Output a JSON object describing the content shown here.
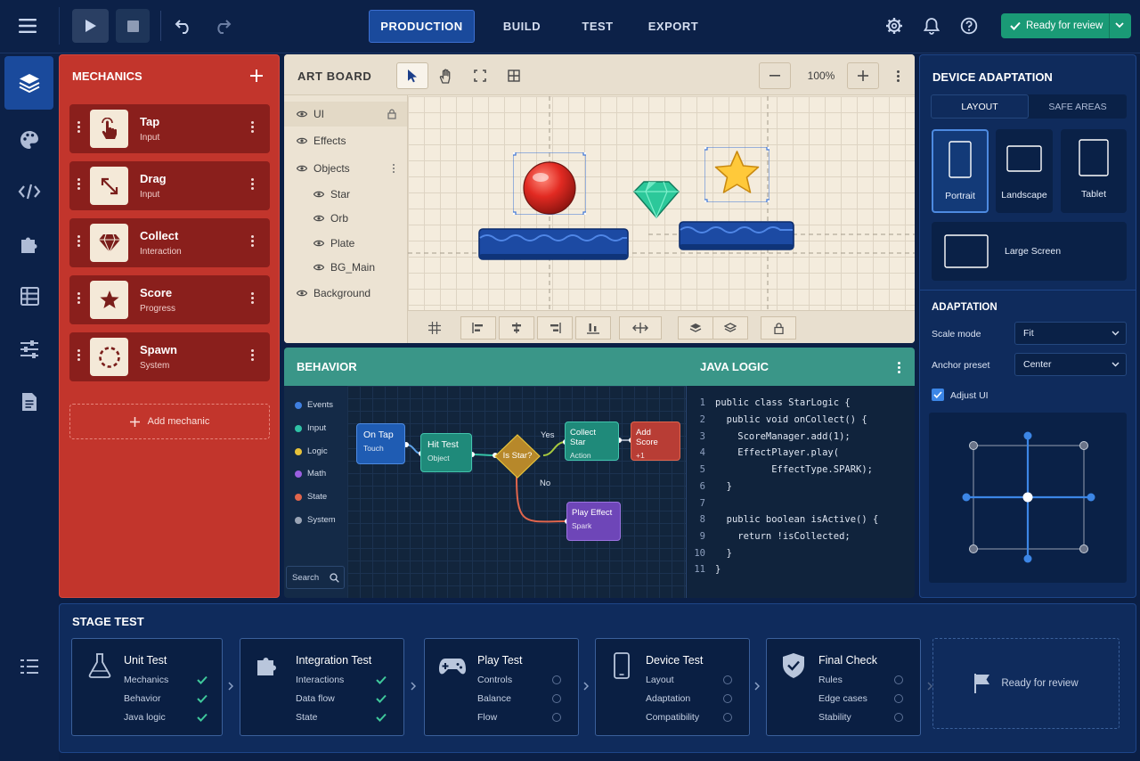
{
  "toolbar": {
    "tabs": [
      "PRODUCTION",
      "BUILD",
      "TEST",
      "EXPORT"
    ],
    "active_tab": "PRODUCTION",
    "review_label": "Ready for review"
  },
  "rail": {
    "icons": [
      "layers-icon",
      "palette-icon",
      "code-icon",
      "puzzle-icon",
      "table-icon",
      "sliders-icon",
      "document-icon"
    ]
  },
  "mechanics": {
    "title": "MECHANICS",
    "items": [
      {
        "title": "Tap",
        "sub": "Input",
        "icon": "tap-icon"
      },
      {
        "title": "Drag",
        "sub": "Input",
        "icon": "drag-icon"
      },
      {
        "title": "Collect",
        "sub": "Interaction",
        "icon": "gem-icon"
      },
      {
        "title": "Score",
        "sub": "Progress",
        "icon": "star-icon"
      },
      {
        "title": "Spawn",
        "sub": "System",
        "icon": "spawn-icon"
      }
    ],
    "add_label": "Add mechanic"
  },
  "artboard": {
    "title": "ART BOARD",
    "zoom": "100%",
    "layers": [
      {
        "label": "UI"
      },
      {
        "label": "Effects"
      },
      {
        "label": "Objects"
      },
      {
        "label": "Star"
      },
      {
        "label": "Orb"
      },
      {
        "label": "Plate"
      },
      {
        "label": "BG_Main"
      },
      {
        "label": "Background"
      }
    ]
  },
  "behavior": {
    "title": "BEHAVIOR",
    "legend": [
      {
        "label": "Events",
        "color": "#3f7fe0"
      },
      {
        "label": "Input",
        "color": "#2fc1a5"
      },
      {
        "label": "Logic",
        "color": "#e6c23a"
      },
      {
        "label": "Math",
        "color": "#9b5fe0"
      },
      {
        "label": "State",
        "color": "#e0654c"
      },
      {
        "label": "System",
        "color": "#9aa4b5"
      }
    ],
    "search_label": "Search",
    "nodes": {
      "on_tap": {
        "title": "On Tap",
        "sub": "Touch"
      },
      "hit_test": {
        "title": "Hit Test",
        "sub": "Object"
      },
      "is_star": {
        "title": "Is Star?"
      },
      "collect_star": {
        "title": "Collect Star",
        "sub": "Action"
      },
      "add_score": {
        "title": "Add Score",
        "sub": "+1"
      },
      "play_effect": {
        "title": "Play Effect",
        "sub": "Spark"
      }
    },
    "yes_label": "Yes",
    "no_label": "No"
  },
  "java": {
    "title": "JAVA LOGIC",
    "lines": [
      {
        "n": "1",
        "code": "public class StarLogic {"
      },
      {
        "n": "2",
        "code": "  public void onCollect() {"
      },
      {
        "n": "3",
        "code": "    ScoreManager.add(1);"
      },
      {
        "n": "4",
        "code": "    EffectPlayer.play("
      },
      {
        "n": "5",
        "code": "          EffectType.SPARK);"
      },
      {
        "n": "6",
        "code": "  }"
      },
      {
        "n": "7",
        "code": ""
      },
      {
        "n": "8",
        "code": "  public boolean isActive() {"
      },
      {
        "n": "9",
        "code": "    return !isCollected;"
      },
      {
        "n": "10",
        "code": "  }"
      },
      {
        "n": "11",
        "code": "}"
      }
    ]
  },
  "device": {
    "title": "DEVICE ADAPTATION",
    "tabs": [
      "LAYOUT",
      "SAFE AREAS"
    ],
    "active_tab": "LAYOUT",
    "formats": [
      "Portrait",
      "Landscape",
      "Tablet",
      "Large Screen"
    ],
    "selected_format": "Portrait",
    "adaptation_title": "ADAPTATION",
    "scale_label": "Scale mode",
    "scale_value": "Fit",
    "anchor_label": "Anchor preset",
    "anchor_value": "Center",
    "adjust_label": "Adjust UI",
    "adjust_checked": true
  },
  "stage": {
    "title": "STAGE TEST",
    "cards": [
      {
        "title": "Unit Test",
        "icon": "flask-icon",
        "rows": [
          {
            "label": "Mechanics",
            "done": true
          },
          {
            "label": "Behavior",
            "done": true
          },
          {
            "label": "Java logic",
            "done": true
          }
        ]
      },
      {
        "title": "Integration Test",
        "icon": "puzzle-icon",
        "rows": [
          {
            "label": "Interactions",
            "done": true
          },
          {
            "label": "Data flow",
            "done": true
          },
          {
            "label": "State",
            "done": true
          }
        ]
      },
      {
        "title": "Play Test",
        "icon": "gamepad-icon",
        "rows": [
          {
            "label": "Controls",
            "done": false
          },
          {
            "label": "Balance",
            "done": false
          },
          {
            "label": "Flow",
            "done": false
          }
        ]
      },
      {
        "title": "Device Test",
        "icon": "phone-icon",
        "rows": [
          {
            "label": "Layout",
            "done": false
          },
          {
            "label": "Adaptation",
            "done": false
          },
          {
            "label": "Compatibility",
            "done": false
          }
        ]
      },
      {
        "title": "Final Check",
        "icon": "shield-check-icon",
        "rows": [
          {
            "label": "Rules",
            "done": false
          },
          {
            "label": "Edge cases",
            "done": false
          },
          {
            "label": "Stability",
            "done": false
          }
        ]
      }
    ],
    "final_label": "Ready for review"
  },
  "colors": {
    "accent": "#1a4a9c",
    "mechanics_bg": "#c2352c",
    "teal": "#3a9688",
    "success": "#1a9a76"
  }
}
